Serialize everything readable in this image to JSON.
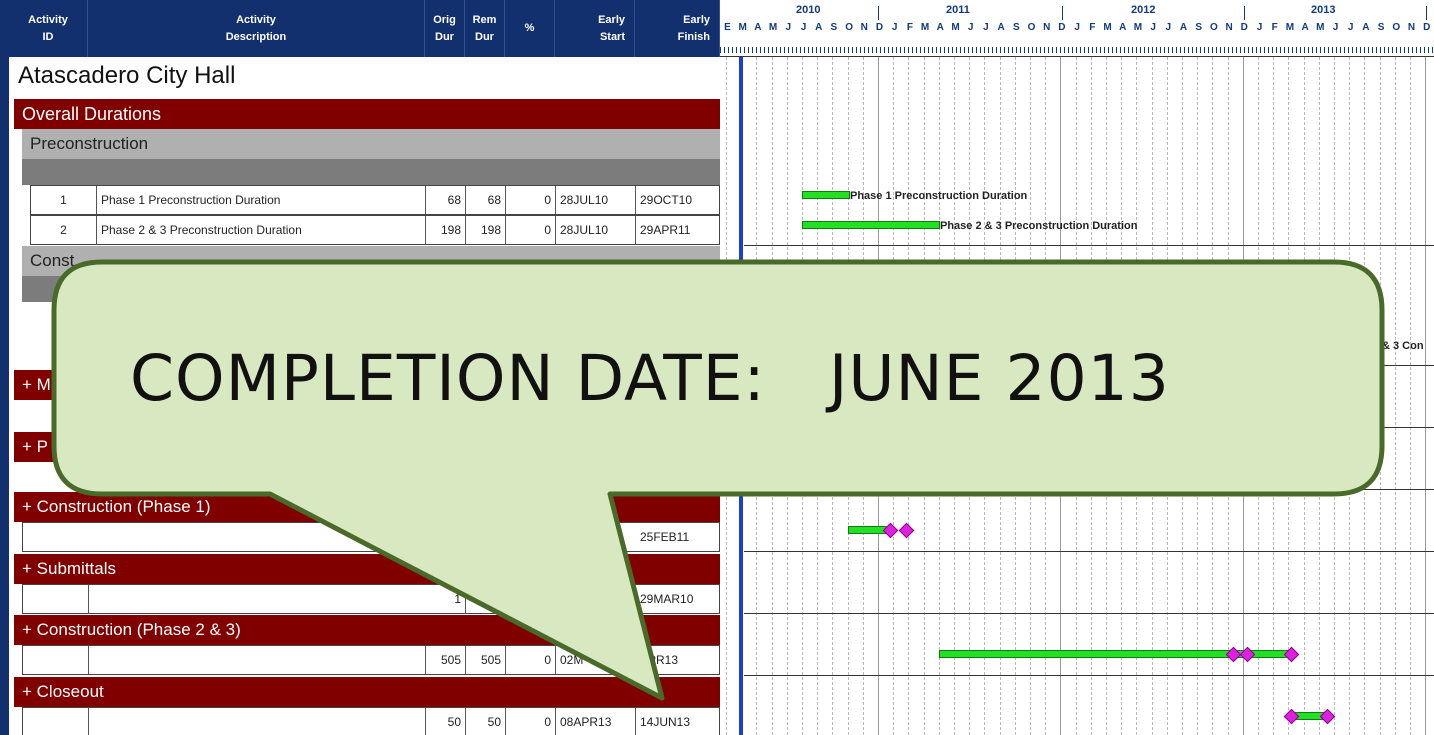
{
  "header": {
    "activity_id": "Activity\nID",
    "activity_description": "Activity\nDescription",
    "orig_dur": "Orig\nDur",
    "rem_dur": "Rem\nDur",
    "pct": "%",
    "early_start": "Early\nStart",
    "early_finish": "Early\nFinish"
  },
  "timeline": {
    "years": [
      "2010",
      "2011",
      "2012",
      "2013"
    ],
    "months": [
      "E",
      "M",
      "A",
      "M",
      "J",
      "J",
      "A",
      "S",
      "O",
      "N",
      "D",
      "J",
      "F",
      "M",
      "A",
      "M",
      "J",
      "J",
      "A",
      "S",
      "O",
      "N",
      "D",
      "J",
      "F",
      "M",
      "A",
      "M",
      "J",
      "J",
      "A",
      "S",
      "O",
      "N",
      "D",
      "J",
      "F",
      "M",
      "A",
      "M",
      "J",
      "J",
      "A",
      "S",
      "O",
      "N",
      "D"
    ]
  },
  "project": {
    "title": "Atascadero City Hall"
  },
  "sections": {
    "overall": "Overall Durations",
    "preconstruction": "Preconstruction",
    "construction_partial": "Const",
    "m_partial": "+ M",
    "p_partial": "+ P",
    "construction_phase1": "+ Construction (Phase 1)",
    "submittals": "+ Submittals",
    "construction_phase23": "+ Construction (Phase 2 & 3)",
    "closeout": "+ Closeout"
  },
  "activities": [
    {
      "id": "1",
      "description": "Phase 1 Preconstruction Duration",
      "orig": "68",
      "rem": "68",
      "pct": "0",
      "start": "28JUL10",
      "finish": "29OCT10"
    },
    {
      "id": "2",
      "description": "Phase 2 & 3 Preconstruction Duration",
      "orig": "198",
      "rem": "198",
      "pct": "0",
      "start": "28JUL10",
      "finish": "29APR11"
    }
  ],
  "summary_rows": {
    "phase1": {
      "finish": "25FEB11"
    },
    "submittals": {
      "orig": "1",
      "finish": "29MAR10"
    },
    "phase23": {
      "orig": "505",
      "rem": "505",
      "pct": "0",
      "start": "02M",
      "finish": "APR13"
    },
    "closeout": {
      "orig": "50",
      "rem": "50",
      "pct": "0",
      "start": "08APR13",
      "finish": "14JUN13"
    }
  },
  "gantt_labels": {
    "bar1": "Phase 1 Preconstruction Duration",
    "bar2": "Phase 2 & 3 Preconstruction Duration",
    "clipped": "& 3 Con"
  },
  "callout": {
    "text": "COMPLETION DATE:   JUNE 2013"
  },
  "colors": {
    "header": "#12306e",
    "section_band": "#800000",
    "group_band": "#b0b0b0",
    "bar": "#22e022",
    "milestone": "#e020e0",
    "data_date": "#1a3fd6",
    "callout_fill": "#d8e8c0",
    "callout_stroke": "#4a6a2a"
  }
}
